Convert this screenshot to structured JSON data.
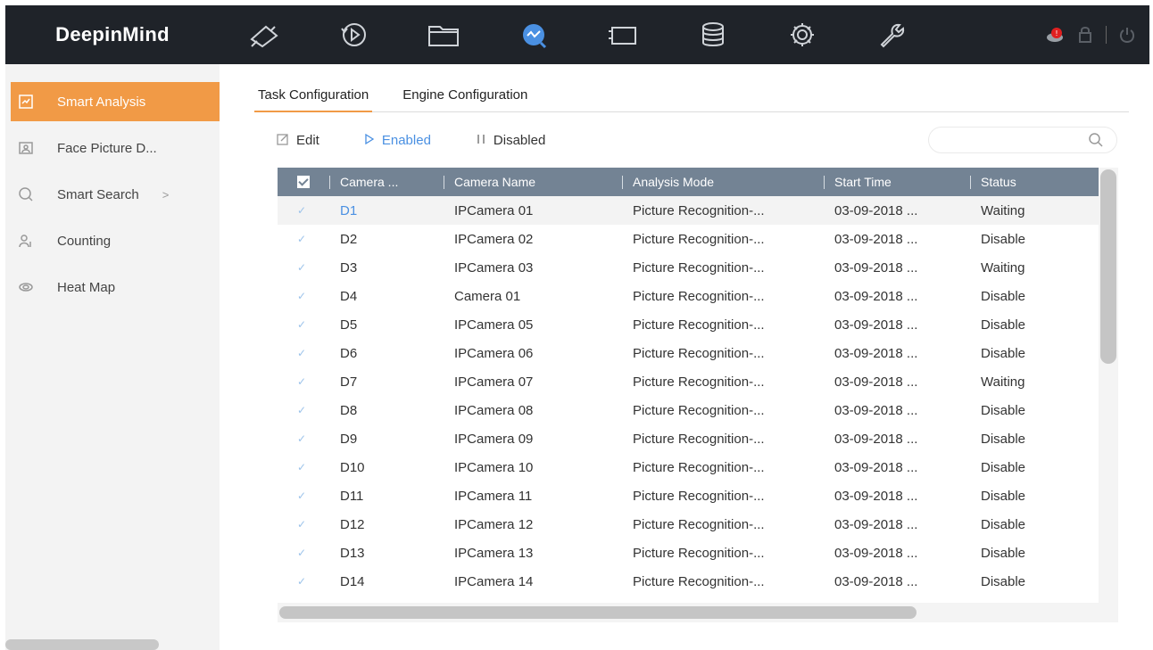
{
  "header": {
    "logo_bold": "DeepinMind",
    "nav": [
      {
        "icon": "live-view-camera-icon"
      },
      {
        "icon": "playback-icon"
      },
      {
        "icon": "file-folder-icon"
      },
      {
        "icon": "smart-analysis-icon",
        "active": true
      },
      {
        "icon": "display-icon"
      },
      {
        "icon": "storage-database-icon"
      },
      {
        "icon": "settings-gear-icon"
      },
      {
        "icon": "maintenance-wrench-icon"
      }
    ],
    "tray": {
      "alarm_badge": "!"
    },
    "accent_color": "#4a90e2"
  },
  "sidebar": {
    "items": [
      {
        "label": "Smart Analysis",
        "icon": "smart-analysis-icon",
        "active": true
      },
      {
        "label": "Face Picture D...",
        "icon": "face-picture-icon"
      },
      {
        "label": "Smart Search",
        "icon": "smart-search-icon",
        "chevron": ">"
      },
      {
        "label": "Counting",
        "icon": "counting-icon"
      },
      {
        "label": "Heat Map",
        "icon": "heat-map-icon"
      }
    ],
    "active_color": "#f19a46"
  },
  "tabs": [
    {
      "label": "Task Configuration",
      "active": true
    },
    {
      "label": "Engine Configuration"
    }
  ],
  "toolbar": {
    "edit_label": "Edit",
    "enabled_label": "Enabled",
    "disabled_label": "Disabled"
  },
  "search": {
    "placeholder": ""
  },
  "table": {
    "columns": [
      "Camera ...",
      "Camera Name",
      "Analysis Mode",
      "Start Time",
      "Status"
    ],
    "rows": [
      [
        "D1",
        "IPCamera 01",
        "Picture Recognition-...",
        "03-09-2018 ...",
        "Waiting"
      ],
      [
        "D2",
        "IPCamera 02",
        "Picture Recognition-...",
        "03-09-2018 ...",
        "Disable"
      ],
      [
        "D3",
        "IPCamera 03",
        "Picture Recognition-...",
        "03-09-2018 ...",
        "Waiting"
      ],
      [
        "D4",
        "Camera 01",
        "Picture Recognition-...",
        "03-09-2018 ...",
        "Disable"
      ],
      [
        "D5",
        "IPCamera 05",
        "Picture Recognition-...",
        "03-09-2018 ...",
        "Disable"
      ],
      [
        "D6",
        "IPCamera 06",
        "Picture Recognition-...",
        "03-09-2018 ...",
        "Disable"
      ],
      [
        "D7",
        "IPCamera 07",
        "Picture Recognition-...",
        "03-09-2018 ...",
        "Waiting"
      ],
      [
        "D8",
        "IPCamera 08",
        "Picture Recognition-...",
        "03-09-2018 ...",
        "Disable"
      ],
      [
        "D9",
        "IPCamera 09",
        "Picture Recognition-...",
        "03-09-2018 ...",
        "Disable"
      ],
      [
        "D10",
        "IPCamera 10",
        "Picture Recognition-...",
        "03-09-2018 ...",
        "Disable"
      ],
      [
        "D11",
        "IPCamera 11",
        "Picture Recognition-...",
        "03-09-2018 ...",
        "Disable"
      ],
      [
        "D12",
        "IPCamera 12",
        "Picture Recognition-...",
        "03-09-2018 ...",
        "Disable"
      ],
      [
        "D13",
        "IPCamera 13",
        "Picture Recognition-...",
        "03-09-2018 ...",
        "Disable"
      ],
      [
        "D14",
        "IPCamera 14",
        "Picture Recognition-...",
        "03-09-2018 ...",
        "Disable"
      ]
    ],
    "header_color": "#738394"
  }
}
